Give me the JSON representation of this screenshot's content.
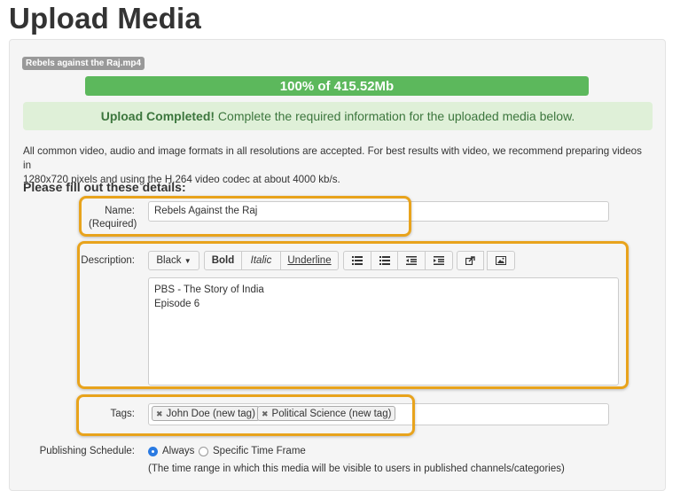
{
  "page": {
    "title": "Upload Media"
  },
  "upload": {
    "filename": "Rebels against the Raj.mp4",
    "progress_label": "100% of 415.52Mb",
    "progress": 1.0,
    "alert_strong": "Upload Completed!",
    "alert_text": " Complete the required information for the uploaded media below."
  },
  "intro": {
    "line1": "All common video, audio and image formats in all resolutions are accepted. For best results with video, we recommend preparing videos in",
    "line2": "1280x720 pixels and using the H.264 video codec at about 4000 kb/s."
  },
  "form": {
    "heading": "Please fill out these details:",
    "name": {
      "label": "Name:",
      "required": "(Required)",
      "value": "Rebels Against the Raj"
    },
    "description": {
      "label": "Description:",
      "toolbar": {
        "color": "Black",
        "bold": "Bold",
        "italic": "Italic",
        "underline": "Underline"
      },
      "lines": [
        "PBS - The Story of India",
        "Episode 6"
      ]
    },
    "tags": {
      "label": "Tags:",
      "items": [
        "John Doe (new tag)",
        "Political Science (new tag)"
      ]
    },
    "schedule": {
      "label": "Publishing Schedule:",
      "options": [
        "Always",
        "Specific Time Frame"
      ],
      "selected": "Always",
      "help": "(The time range in which this media will be visible to users in published channels/categories)"
    }
  },
  "colors": {
    "highlight": "#e8a31c",
    "progress": "#5cb85c",
    "alert_bg": "#dff0d8",
    "alert_text": "#3c763d"
  }
}
